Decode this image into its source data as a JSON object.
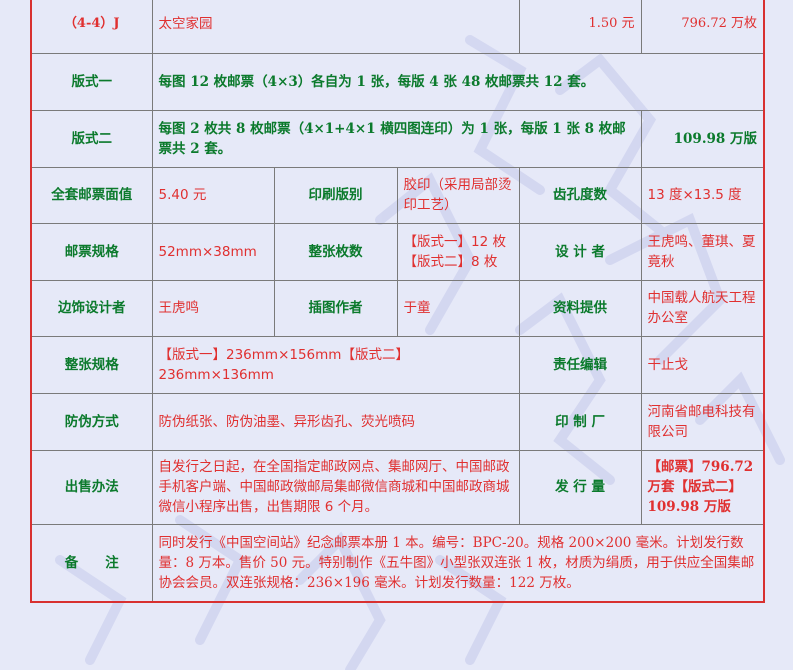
{
  "colors": {
    "background": "#e6e9f8",
    "label_green": "#0b7a2c",
    "value_red": "#e03030",
    "outer_border": "#d83030"
  },
  "row_top": {
    "code": "（4-4）J",
    "name": "太空家园",
    "face_value": "1.50 元",
    "quantity": "796.72 万枚"
  },
  "format1": {
    "label": "版式一",
    "desc": "每图 12 枚邮票（4×3）各自为 1 张，每版 4 张 48 枚邮票共 12 套。"
  },
  "format2": {
    "label": "版式二",
    "desc": "每图 2 枚共 8 枚邮票（4×1+4×1 横四图连印）为 1 张，每版 1 张 8 枚邮票共 2 套。",
    "quantity": "109.98 万版"
  },
  "row_face": {
    "label": "全套邮票面值",
    "value": "5.40 元",
    "print_label": "印刷版别",
    "print_value": "胶印（采用局部烫印工艺）",
    "perf_label": "齿孔度数",
    "perf_value": "13 度×13.5 度"
  },
  "row_spec": {
    "label": "邮票规格",
    "value": "52mm×38mm",
    "count_label": "整张枚数",
    "count_line1": "【版式一】12 枚",
    "count_line2": "【版式二】8 枚",
    "designer_label": "设 计 者",
    "designer_value": "王虎鸣、董琪、夏竟秋"
  },
  "row_border": {
    "label": "边饰设计者",
    "value": "王虎鸣",
    "illus_label": "插图作者",
    "illus_value": "于童",
    "source_label": "资料提供",
    "source_value": "中国载人航天工程办公室"
  },
  "row_sheet": {
    "label": "整张规格",
    "value": "【版式一】236mm×156mm【版式二】236mm×136mm",
    "editor_label": "责任编辑",
    "editor_value": "干止戈"
  },
  "row_security": {
    "label": "防伪方式",
    "value": "防伪纸张、防伪油墨、异形齿孔、荧光喷码",
    "printer_label": "印 制 厂",
    "printer_value": "河南省邮电科技有限公司"
  },
  "row_sale": {
    "label": "出售办法",
    "value": "自发行之日起，在全国指定邮政网点、集邮网厅、中国邮政手机客户端、中国邮政微邮局集邮微信商城和中国邮政商城微信小程序出售，出售期限 6 个月。",
    "issue_label": "发 行 量",
    "issue_value": "【邮票】796.72 万套【版式二】109.98 万版"
  },
  "row_note": {
    "label": "备　　注",
    "value": "同时发行《中国空间站》纪念邮票本册 1 本。编号：BPC-20。规格 200×200 毫米。计划发行数量：8 万本。售价 50 元。特别制作《五牛图》小型张双连张 1 枚，材质为绢质，用于供应全国集邮协会会员。双连张规格：236×196 毫米。计划发行数量：122 万枚。"
  }
}
